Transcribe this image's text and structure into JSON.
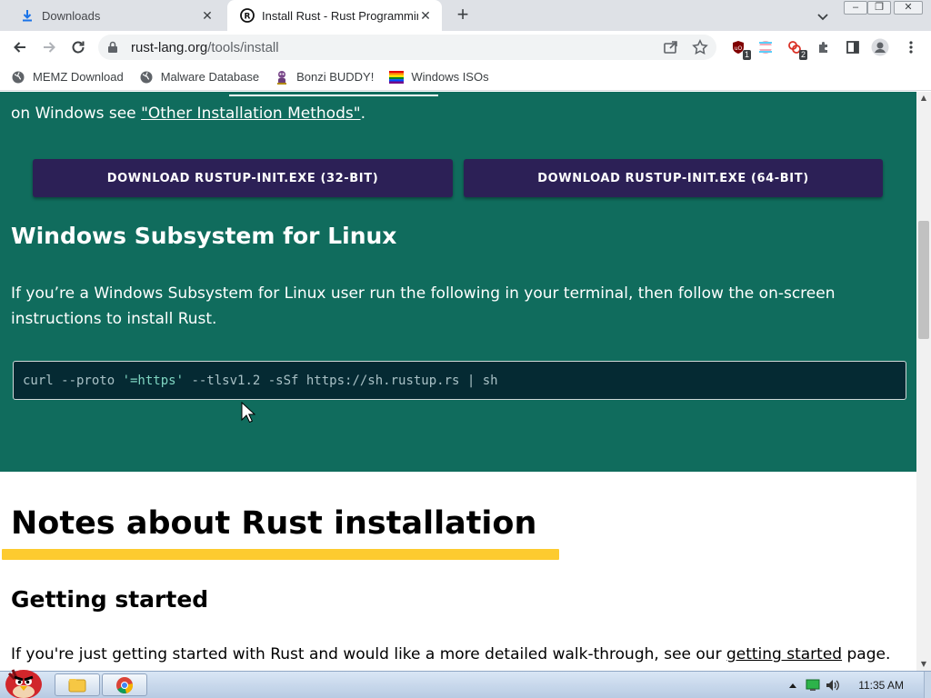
{
  "browser": {
    "tabs": [
      {
        "title": "Downloads",
        "icon": "download-icon",
        "active": false
      },
      {
        "title": "Install Rust - Rust Programmin",
        "icon": "rust-logo-icon",
        "active": true
      }
    ],
    "new_tab_symbol": "+",
    "tab_close_symbol": "✕",
    "window_controls": {
      "minimize": "–",
      "restore": "❐",
      "close": "✕"
    },
    "url": {
      "host": "rust-lang.org",
      "path": "/tools/install"
    },
    "bookmarks": [
      {
        "label": "MEMZ Download",
        "icon": "globe-icon"
      },
      {
        "label": "Malware Database",
        "icon": "globe-icon"
      },
      {
        "label": "Bonzi BUDDY!",
        "icon": "bonzi-icon"
      },
      {
        "label": "Windows ISOs",
        "icon": "rainbow-flag-icon"
      }
    ],
    "extension_badges": [
      "1",
      "2"
    ]
  },
  "page": {
    "other_methods_prefix": "on Windows see ",
    "other_methods_link": "\"Other Installation Methods\"",
    "other_methods_suffix": ".",
    "download_32": "DOWNLOAD RUSTUP-INIT.EXE (32-BIT)",
    "download_64": "DOWNLOAD RUSTUP-INIT.EXE (64-BIT)",
    "wsl_heading": "Windows Subsystem for Linux",
    "wsl_text": "If you’re a Windows Subsystem for Linux user run the following in your terminal, then follow the on-screen instructions to install Rust.",
    "code": {
      "c1": "curl --proto ",
      "s1": "'=https'",
      "c2": " --tlsv1.2 -sSf https://sh.rustup.rs | sh"
    },
    "notes_heading": "Notes about Rust installation",
    "getting_started_heading": "Getting started",
    "getting_started_prefix": "If you're just getting started with Rust and would like a more detailed walk-through, see our ",
    "getting_started_link": "getting started",
    "getting_started_suffix": " page."
  },
  "taskbar": {
    "clock": "11:35 AM"
  },
  "colors": {
    "page_green": "#106c5d",
    "button_purple": "#2c2056",
    "underline_yellow": "#fdcb2f",
    "code_bg": "#052a33"
  }
}
